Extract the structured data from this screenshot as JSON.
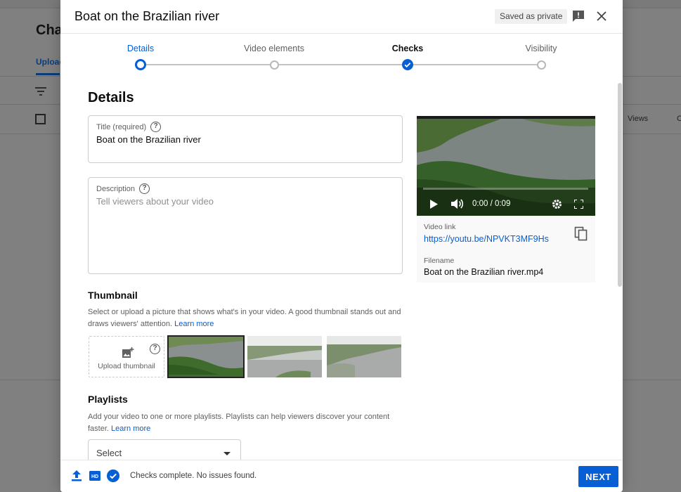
{
  "background": {
    "page_title": "Char",
    "tab_label": "Uploac",
    "col_views": "Views",
    "col_extra": "C"
  },
  "modal": {
    "title": "Boat on the Brazilian river",
    "saved_badge": "Saved as private"
  },
  "stepper": {
    "steps": [
      {
        "label": "Details",
        "state": "current"
      },
      {
        "label": "Video elements",
        "state": "pending"
      },
      {
        "label": "Checks",
        "state": "done"
      },
      {
        "label": "Visibility",
        "state": "pending"
      }
    ]
  },
  "details": {
    "heading": "Details",
    "title_field": {
      "label": "Title (required)",
      "value": "Boat on the Brazilian river"
    },
    "description_field": {
      "label": "Description",
      "placeholder": "Tell viewers about your video"
    }
  },
  "thumbnail": {
    "heading": "Thumbnail",
    "text": "Select or upload a picture that shows what's in your video. A good thumbnail stands out and draws viewers' attention.",
    "link": "Learn more",
    "upload_label": "Upload thumbnail"
  },
  "playlists": {
    "heading": "Playlists",
    "text": "Add your video to one or more playlists. Playlists can help viewers discover your content faster.",
    "link": "Learn more",
    "select_value": "Select"
  },
  "video_card": {
    "time": "0:00 / 0:09",
    "video_link_label": "Video link",
    "video_link": "https://youtu.be/NPVKT3MF9Hs",
    "filename_label": "Filename",
    "filename": "Boat on the Brazilian river.mp4"
  },
  "footer": {
    "status": "Checks complete. No issues found.",
    "next_label": "NEXT"
  },
  "colors": {
    "accent": "#065fd4",
    "text": "#0d0d0d",
    "muted": "#606060"
  }
}
